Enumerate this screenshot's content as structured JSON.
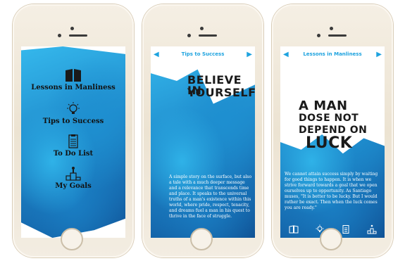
{
  "phone1": {
    "menu": [
      {
        "label": "Lessons in Manliness",
        "icon": "book-icon"
      },
      {
        "label": "Tips to Success",
        "icon": "lightbulb-icon"
      },
      {
        "label": "To Do List",
        "icon": "clipboard-icon"
      },
      {
        "label": "My Goals",
        "icon": "podium-icon"
      }
    ]
  },
  "phone2": {
    "title": "Tips to Success",
    "headline_1": "BELIEVE IN",
    "headline_2": "YOURSELF",
    "body": "A simple story on the surface, but also a tale with a much deeper message and a relevance that transcends time and place. It speaks to the universal truths of a man's existence within this world, where pride, respect, tenacity, and dreams fuel a man in his quest to thrive in the face of struggle."
  },
  "phone3": {
    "title": "Lessons in Manliness",
    "headline_1": "A MAN",
    "headline_2": "DOSE NOT",
    "headline_3": "DEPEND ON",
    "headline_4": "LUCK",
    "body": "We cannot attain success simply by waiting for good things to happen. It is when we strive forward towards a goal that we open ourselves up to opportunity. As Santiago muses, \"It is better to be lucky. But I would rather be exact. Then when the luck comes you are ready.\""
  },
  "colors": {
    "accent": "#1ea3df",
    "paint_blue": "#1f8ccd"
  }
}
